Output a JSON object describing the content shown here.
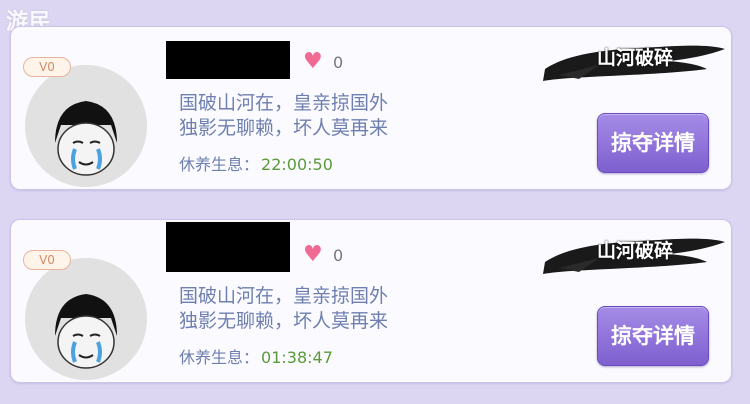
{
  "watermark": "游民",
  "cards": [
    {
      "vip": "V0",
      "likes": "0",
      "poem_line1": "国破山河在，皇亲掠国外",
      "poem_line2": "独影无聊赖，坏人莫再来",
      "rest_label": "休养生息：",
      "rest_time": "22:00:50",
      "badge_text": "山河破碎",
      "button_label": "掠夺详情"
    },
    {
      "vip": "V0",
      "likes": "0",
      "poem_line1": "国破山河在，皇亲掠国外",
      "poem_line2": "独影无聊赖，坏人莫再来",
      "rest_label": "休养生息：",
      "rest_time": "01:38:47",
      "badge_text": "山河破碎",
      "button_label": "掠夺详情"
    }
  ],
  "icons": {
    "heart": "heart-icon",
    "avatar": "crying-meme-avatar",
    "brush": "ink-brush-stroke"
  },
  "colors": {
    "background": "#dcd6f2",
    "heart": "#f06a93",
    "button": "#7e5fcf",
    "time": "#5b9a3a"
  }
}
